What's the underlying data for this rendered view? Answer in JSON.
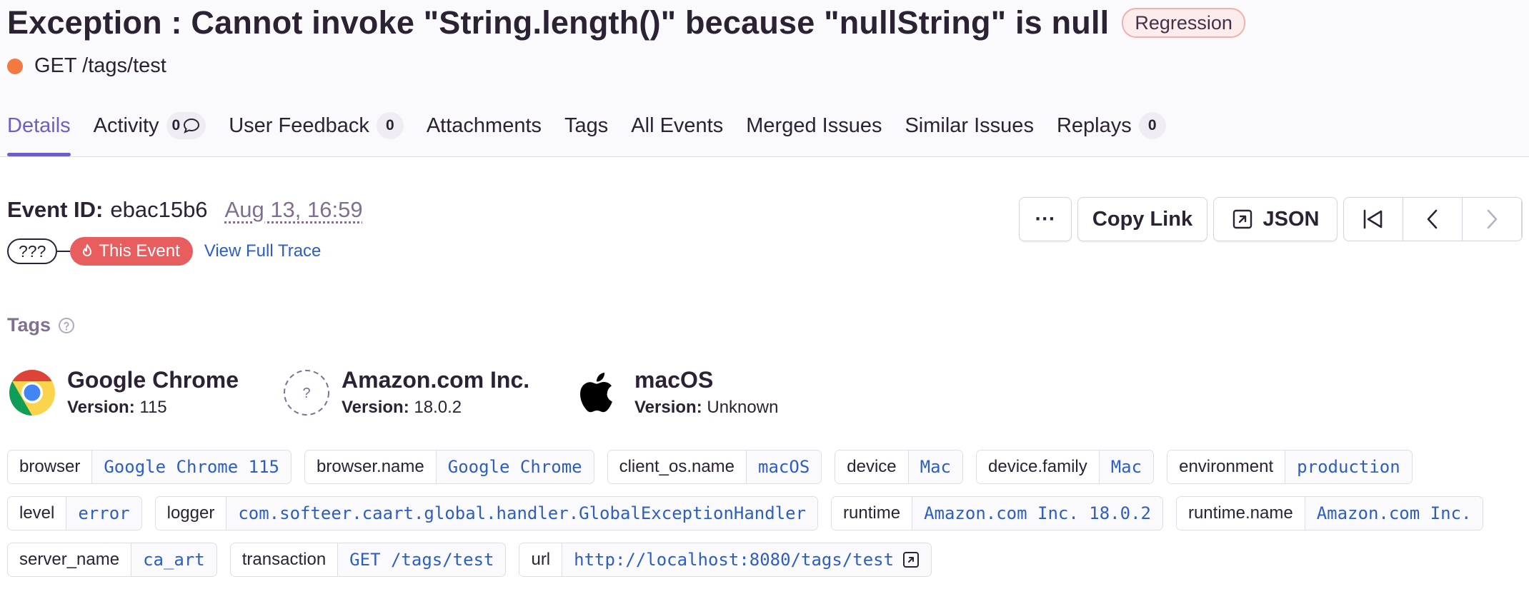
{
  "header": {
    "title": "Exception : Cannot invoke \"String.length()\" because \"nullString\" is null",
    "badge": "Regression",
    "culprit": "GET /tags/test"
  },
  "tabs": [
    {
      "label": "Details",
      "active": true
    },
    {
      "label": "Activity",
      "count": "0"
    },
    {
      "label": "User Feedback",
      "count": "0"
    },
    {
      "label": "Attachments"
    },
    {
      "label": "Tags"
    },
    {
      "label": "All Events"
    },
    {
      "label": "Merged Issues"
    },
    {
      "label": "Similar Issues"
    },
    {
      "label": "Replays",
      "count": "0"
    }
  ],
  "event": {
    "id_label": "Event ID:",
    "id": "ebac15b6",
    "date": "Aug 13, 16:59",
    "trace_unknown": "???",
    "trace_this": "This Event",
    "view_full_trace": "View Full Trace"
  },
  "actions": {
    "more": "···",
    "copy_link": "Copy Link",
    "json": "JSON"
  },
  "tags_section": {
    "heading": "Tags"
  },
  "contexts": [
    {
      "name": "Google Chrome",
      "version_label": "Version:",
      "version": "115",
      "icon": "chrome-icon"
    },
    {
      "name": "Amazon.com Inc.",
      "version_label": "Version:",
      "version": "18.0.2",
      "icon": "unknown-icon"
    },
    {
      "name": "macOS",
      "version_label": "Version:",
      "version": "Unknown",
      "icon": "apple-icon"
    }
  ],
  "tag_rows": [
    [
      {
        "key": "browser",
        "value": "Google Chrome 115"
      },
      {
        "key": "browser.name",
        "value": "Google Chrome"
      },
      {
        "key": "client_os.name",
        "value": "macOS"
      },
      {
        "key": "device",
        "value": "Mac"
      },
      {
        "key": "device.family",
        "value": "Mac"
      },
      {
        "key": "environment",
        "value": "production"
      }
    ],
    [
      {
        "key": "level",
        "value": "error"
      },
      {
        "key": "logger",
        "value": "com.softeer.caart.global.handler.GlobalExceptionHandler"
      },
      {
        "key": "runtime",
        "value": "Amazon.com Inc. 18.0.2"
      },
      {
        "key": "runtime.name",
        "value": "Amazon.com Inc."
      }
    ],
    [
      {
        "key": "server_name",
        "value": "ca_art"
      },
      {
        "key": "transaction",
        "value": "GET /tags/test"
      },
      {
        "key": "url",
        "value": "http://localhost:8080/tags/test",
        "external": true
      }
    ]
  ],
  "colors": {
    "accent": "#6c5fc7",
    "link": "#2c5ec4",
    "level_dot": "#f2793f",
    "this_event": "#e85d5d",
    "regression_border": "#f1b0b0"
  }
}
